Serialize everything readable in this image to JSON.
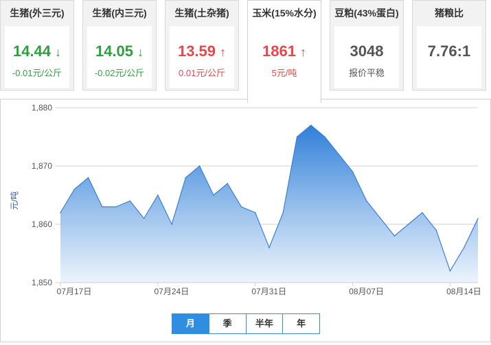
{
  "cards": [
    {
      "title": "生猪(外三元)",
      "price": "14.44",
      "arrow": "↓",
      "change": "-0.01元/公斤",
      "color": "#2e9e3f"
    },
    {
      "title": "生猪(内三元)",
      "price": "14.05",
      "arrow": "↓",
      "change": "-0.02元/公斤",
      "color": "#2e9e3f"
    },
    {
      "title": "生猪(土杂猪)",
      "price": "13.59",
      "arrow": "↑",
      "change": "0.01元/公斤",
      "color": "#e5474b"
    },
    {
      "title": "玉米(15%水分)",
      "price": "1861",
      "arrow": "↑",
      "change": "5元/吨",
      "color": "#e5474b"
    },
    {
      "title": "豆粕(43%蛋白)",
      "price": "3048",
      "arrow": "",
      "change": "报价平稳",
      "color": "#555555"
    },
    {
      "title": "猪粮比",
      "price": "7.76:1",
      "arrow": "",
      "change": "",
      "color": "#555555"
    }
  ],
  "active_card": 3,
  "toggle": {
    "month": "月",
    "season": "季",
    "half_year": "半年",
    "year": "年"
  },
  "chart_data": {
    "type": "area",
    "title": "",
    "xlabel": "",
    "ylabel": "元/吨",
    "ylim": [
      1850,
      1880
    ],
    "yticks": [
      1850,
      1860,
      1870,
      1880
    ],
    "ytick_labels": [
      "1,850",
      "1,860",
      "1,870",
      "1,880"
    ],
    "grid": true,
    "x_tick_labels": [
      "07月17日",
      "07月24日",
      "07月31日",
      "08月07日",
      "08月14日"
    ],
    "x_tick_index": [
      0,
      7,
      14,
      21,
      28
    ],
    "x": [
      "07-17",
      "07-18",
      "07-19",
      "07-20",
      "07-21",
      "07-22",
      "07-23",
      "07-24",
      "07-25",
      "07-26",
      "07-27",
      "07-28",
      "07-29",
      "07-30",
      "07-31",
      "08-01",
      "08-02",
      "08-03",
      "08-04",
      "08-05",
      "08-06",
      "08-07",
      "08-08",
      "08-09",
      "08-10",
      "08-11",
      "08-12",
      "08-13",
      "08-14",
      "08-15"
    ],
    "values": [
      1862,
      1866,
      1868,
      1863,
      1863,
      1864,
      1861,
      1865,
      1860,
      1868,
      1870,
      1865,
      1867,
      1863,
      1862,
      1856,
      1862,
      1875,
      1877,
      1875,
      1872,
      1869,
      1864,
      1861,
      1858,
      1860,
      1862,
      1859,
      1852,
      1856,
      1861
    ],
    "line_color": "#3a7fd5",
    "fill_top": "#2f7fd8",
    "fill_bottom": "#eaf2fc"
  }
}
